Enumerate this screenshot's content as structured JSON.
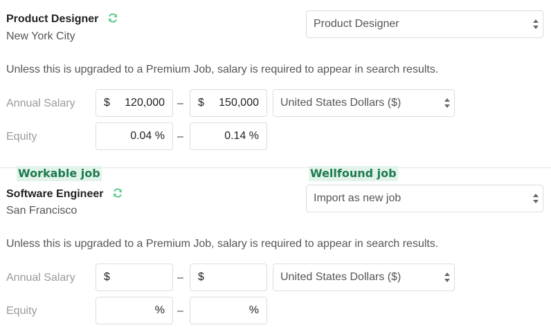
{
  "job1": {
    "title": "Product Designer",
    "location": "New York City",
    "select_value": "Product Designer",
    "note": "Unless this is upgraded to a Premium Job, salary is required to appear in search results.",
    "salary_label": "Annual Salary",
    "salary_min_prefix": "$",
    "salary_min": "120,000",
    "salary_sep": "–",
    "salary_max_prefix": "$",
    "salary_max": "150,000",
    "currency": "United States Dollars ($)",
    "equity_label": "Equity",
    "equity_min": "0.04 %",
    "equity_sep": "–",
    "equity_max": "0.14 %"
  },
  "tags": {
    "workable": "Workable job",
    "wellfound": "Wellfound job"
  },
  "job2": {
    "title": "Software Engineer",
    "location": "San Francisco",
    "select_value": "Import as new job",
    "note": "Unless this is upgraded to a Premium Job, salary is required to appear in search results.",
    "salary_label": "Annual Salary",
    "salary_min_prefix": "$",
    "salary_min": "",
    "salary_sep": "–",
    "salary_max_prefix": "$",
    "salary_max": "",
    "currency": "United States Dollars ($)",
    "equity_label": "Equity",
    "equity_min": "%",
    "equity_sep": "–",
    "equity_max": "%"
  },
  "colors": {
    "sync_icon": "#5cc98a",
    "tag_bg": "#e2f3ea",
    "tag_text": "#1e7a4f"
  },
  "icons": {
    "sync": "sync-icon",
    "select_arrows": "chevron-updown-icon"
  }
}
